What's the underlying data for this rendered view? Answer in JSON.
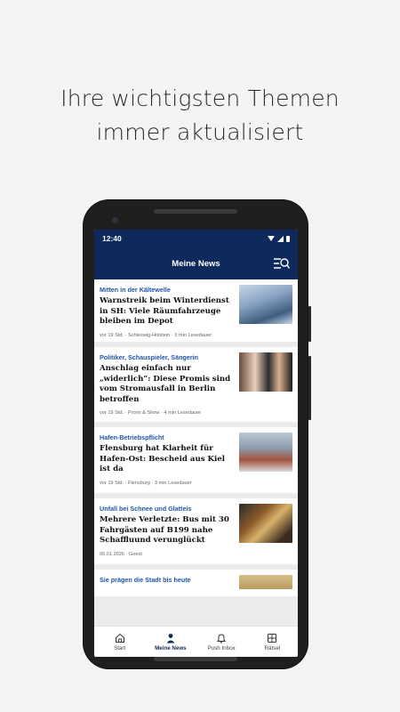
{
  "headline": {
    "line1": "Ihre wichtigsten Themen",
    "line2": "immer aktualisiert"
  },
  "status_bar": {
    "time": "12:40",
    "icons": [
      "wifi-icon",
      "signal-icon",
      "battery-icon"
    ]
  },
  "app_bar": {
    "title": "Meine News",
    "action_icon": "menu-search-icon"
  },
  "articles": [
    {
      "kicker": "Mitten in der Kältewelle",
      "title": "Warnstreik beim Winterdienst in SH: Viele Räumfahrzeuge bleiben im Depot",
      "meta": "vor 19 Std. · Schleswig-Holstein · 3 min Lesedauer"
    },
    {
      "kicker": "Politiker, Schauspieler, Sängerin",
      "title": "Anschlag einfach nur „widerlich“: Diese Promis sind vom Stromausfall in Berlin betroffen",
      "meta": "vor 19 Std. · Promi & Show · 4 min Lesedauer"
    },
    {
      "kicker": "Hafen-Betriebspflicht",
      "title": "Flensburg hat Klarheit für Hafen-Ost: Bescheid aus Kiel ist da",
      "meta": "vor 19 Std. · Flensburg · 3 min Lesedauer"
    },
    {
      "kicker": "Unfall bei Schnee und Glatteis",
      "title": "Mehrere Verletzte: Bus mit 30 Fahrgästen auf B199 nahe Schaffluund verunglückt",
      "meta": "05.01.2026 · Geest"
    },
    {
      "kicker": "Sie prägen die Stadt bis heute",
      "title": "",
      "meta": ""
    }
  ],
  "bottom_nav": [
    {
      "label": "Start",
      "icon": "home-icon",
      "active": false
    },
    {
      "label": "Meine News",
      "icon": "person-icon",
      "active": true
    },
    {
      "label": "Push Inbox",
      "icon": "bell-icon",
      "active": false
    },
    {
      "label": "Rätsel",
      "icon": "puzzle-icon",
      "active": false
    }
  ],
  "colors": {
    "brand": "#0e2a5c",
    "kicker": "#1f57a6",
    "background": "#f4f4f4"
  }
}
